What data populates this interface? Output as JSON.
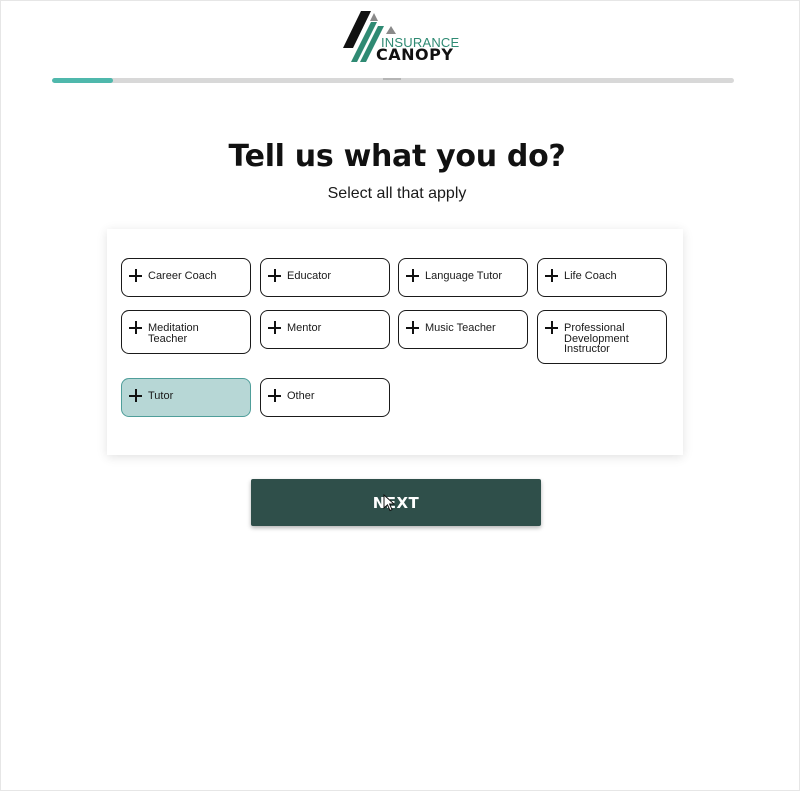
{
  "brand": {
    "word_top": "INSURANCE",
    "word_bottom": "CANOPY",
    "primary_color": "#2f8a73",
    "dark_color": "#111111"
  },
  "progress": {
    "value_percent": 9,
    "track_color": "#d8d8d8",
    "fill_color": "#4fb8ac"
  },
  "header": {
    "title": "Tell us what you do?",
    "subtitle": "Select all that apply"
  },
  "options": [
    {
      "label": "Career Coach",
      "selected": false
    },
    {
      "label": "Educator",
      "selected": false
    },
    {
      "label": "Language Tutor",
      "selected": false
    },
    {
      "label": "Life Coach",
      "selected": false
    },
    {
      "label": "Meditation Teacher",
      "selected": false
    },
    {
      "label": "Mentor",
      "selected": false
    },
    {
      "label": "Music Teacher",
      "selected": false
    },
    {
      "label": "Professional Development Instructor",
      "selected": false
    },
    {
      "label": "Tutor",
      "selected": true
    },
    {
      "label": "Other",
      "selected": false
    }
  ],
  "option_icon": "plus-icon",
  "selected_color": "#b7d7d6",
  "next_button": {
    "label": "NEXT",
    "color": "#2f4f4a"
  }
}
